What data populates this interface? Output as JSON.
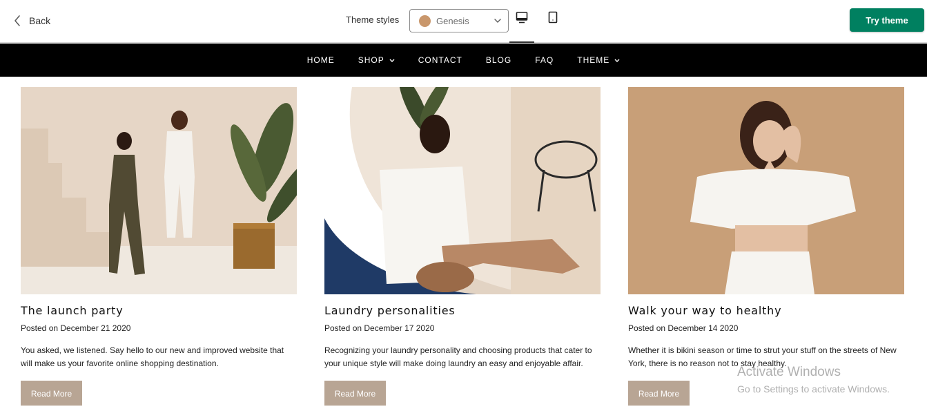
{
  "editor": {
    "back_label": "Back",
    "theme_styles_label": "Theme styles",
    "theme_style_value": "Genesis",
    "theme_swatch_color": "#c9976c",
    "device_desktop_icon": "desktop-icon",
    "device_mobile_icon": "mobile-icon",
    "try_theme_label": "Try theme",
    "accent_color": "#008060"
  },
  "store_nav": {
    "items": [
      {
        "label": "HOME",
        "has_dropdown": false
      },
      {
        "label": "SHOP",
        "has_dropdown": true
      },
      {
        "label": "CONTACT",
        "has_dropdown": false
      },
      {
        "label": "BLOG",
        "has_dropdown": false
      },
      {
        "label": "FAQ",
        "has_dropdown": false
      },
      {
        "label": "THEME",
        "has_dropdown": true
      }
    ]
  },
  "blog": {
    "read_more_label": "Read More",
    "button_color": "#b8a594",
    "posts": [
      {
        "title": "The launch party",
        "date": "Posted on December 21 2020",
        "excerpt": "You asked, we listened. Say hello to our new and improved website that will make us your favorite online shopping destination."
      },
      {
        "title": "Laundry personalities",
        "date": "Posted on December 17 2020",
        "excerpt": "Recognizing your laundry personality and choosing products that cater to your unique style will make doing laundry an easy and enjoyable affair."
      },
      {
        "title": "Walk your way to healthy",
        "date": "Posted on December 14 2020",
        "excerpt": "Whether it is bikini season or time to strut your stuff on the streets of New York, there is no reason not to stay healthy."
      }
    ]
  },
  "watermark": {
    "title": "Activate Windows",
    "subtitle": "Go to Settings to activate Windows."
  }
}
